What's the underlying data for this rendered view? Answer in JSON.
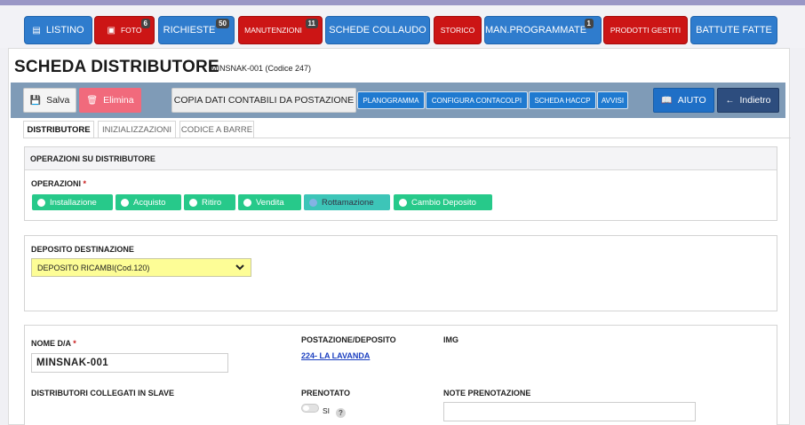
{
  "nav": {
    "listino": "LISTINO",
    "foto": "FOTO",
    "foto_badge": "6",
    "richieste": "RICHIESTE",
    "richieste_badge": "50",
    "manutenzioni": "MANUTENZIONI",
    "manutenzioni_badge": "11",
    "schede_collaudo": "SCHEDE COLLAUDO",
    "storico": "STORICO",
    "man_programmate": "MAN.PROGRAMMATE",
    "man_programmate_badge": "1",
    "prodotti_gestiti": "PRODOTTI GESTITI",
    "battute_fatte": "BATTUTE FATTE"
  },
  "header": {
    "title": "SCHEDA DISTRIBUTORE",
    "subtitle": "MINSNAK-001 (Codice 247)"
  },
  "toolbar": {
    "salva": "Salva",
    "elimina": "Elimina",
    "copia": "COPIA DATI CONTABILI DA POSTAZIONE",
    "planogramma": "PLANOGRAMMA",
    "configura": "CONFIGURA CONTACOLPI",
    "haccp": "SCHEDA HACCP",
    "avvisi": "AVVISI",
    "aiuto": "AIUTO",
    "indietro": "Indietro"
  },
  "tabs": [
    "DISTRIBUTORE",
    "INIZIALIZZAZIONI",
    "CODICE A BARRE"
  ],
  "operazioni": {
    "heading": "OPERAZIONI SU DISTRIBUTORE",
    "label": "OPERAZIONI",
    "required_mark": "*",
    "options": [
      "Installazione",
      "Acquisto",
      "Ritiro",
      "Vendita",
      "Rottamazione",
      "Cambio Deposito"
    ],
    "selected": "Rottamazione"
  },
  "deposito": {
    "label": "DEPOSITO DESTINAZIONE",
    "value": "DEPOSITO RICAMBI(Cod.120)"
  },
  "dettagli": {
    "nome_label": "NOME D/A",
    "nome_required": "*",
    "nome_value": "MINSNAK-001",
    "postazione_label": "POSTAZIONE/DEPOSITO",
    "postazione_link": "224- LA LAVANDA",
    "img_label": "IMG",
    "slave_label": "DISTRIBUTORI COLLEGATI IN SLAVE",
    "prenotato_label": "PRENOTATO",
    "prenotato_toggle": "SI",
    "help": "?",
    "note_label": "NOTE PRENOTAZIONE",
    "note_value": ""
  },
  "colors": {
    "nav_blue": "#2f7ccd",
    "nav_red": "#cc1515",
    "radio_green": "#27c98a",
    "select_yellow": "#fdfd96",
    "toolbar_bg": "#7f9bb7"
  }
}
